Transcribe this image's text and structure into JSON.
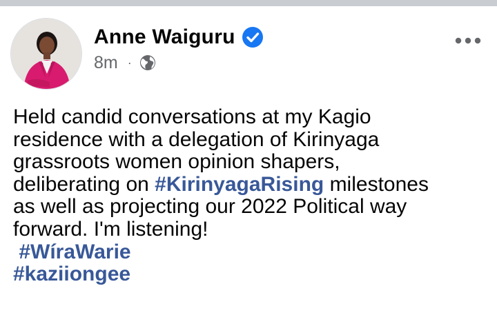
{
  "post": {
    "author": "Anne Waiguru",
    "verified_icon": "verified-badge-icon",
    "timestamp": "8m",
    "separator": "·",
    "audience_icon": "globe-icon",
    "more_icon": "more-options-icon",
    "body": {
      "line1": "Held candid conversations at my Kagio",
      "line2": "residence with a delegation of Kirinyaga",
      "line3": "grassroots women opinion shapers,",
      "line4_pre": "deliberating on ",
      "line4_tag": "#KirinyagaRising",
      "line4_post": " milestones",
      "line5": "as well as projecting our 2022 Political way",
      "line6": "forward. I'm listening!",
      "tag1": "#WíraWarie",
      "tag2": "#kaziiongee"
    }
  },
  "colors": {
    "link": "#385898",
    "verified": "#1877f2",
    "meta": "#65676b",
    "text": "#050505"
  }
}
